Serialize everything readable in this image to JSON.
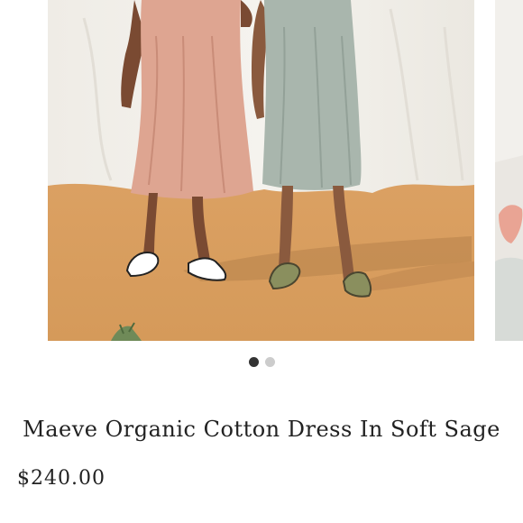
{
  "product": {
    "title": "Maeve Organic Cotton Dress In Soft Sage",
    "price": "$240.00"
  },
  "carousel": {
    "slide_count": 2,
    "active_index": 0
  },
  "colors": {
    "dot_active": "#333333",
    "dot_inactive": "#cccccc",
    "text": "#222222",
    "sand": "#dca063",
    "backdrop": "#f1efe9",
    "dress_pink": "#dea591",
    "dress_sage": "#a9b6ad"
  }
}
